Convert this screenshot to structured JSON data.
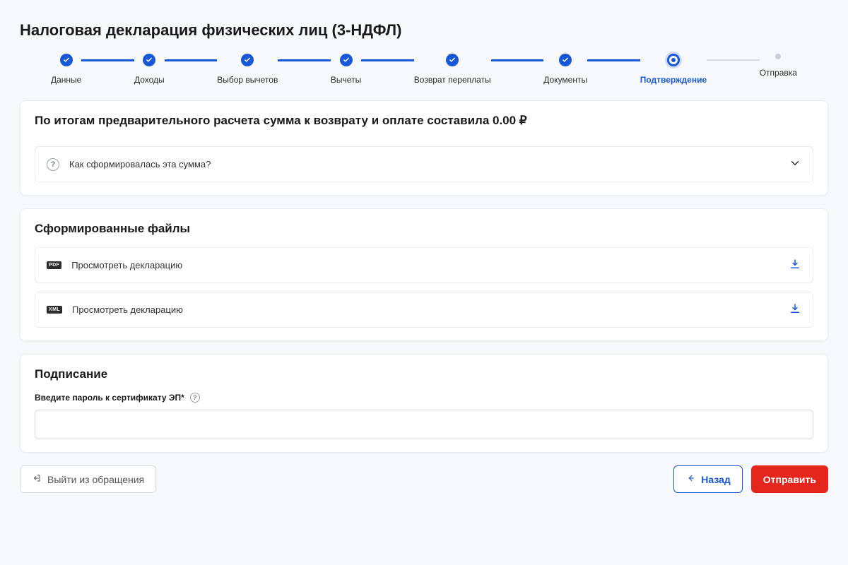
{
  "page": {
    "title": "Налоговая декларация физических лиц (3-НДФЛ)"
  },
  "stepper": {
    "steps": [
      {
        "label": "Данные"
      },
      {
        "label": "Доходы"
      },
      {
        "label": "Выбор вычетов"
      },
      {
        "label": "Вычеты"
      },
      {
        "label": "Возврат переплаты"
      },
      {
        "label": "Документы"
      },
      {
        "label": "Подтверждение"
      },
      {
        "label": "Отправка"
      }
    ]
  },
  "summary": {
    "title": "По итогам предварительного расчета сумма к возврату и оплате составила 0.00 ₽",
    "how_formed": "Как сформировалась эта сумма?"
  },
  "files": {
    "title": "Сформированные файлы",
    "items": [
      {
        "badge": "PDF",
        "label": "Просмотреть декларацию"
      },
      {
        "badge": "XML",
        "label": "Просмотреть декларацию"
      }
    ]
  },
  "sign": {
    "title": "Подписание",
    "label": "Введите пароль к сертификату ЭП*",
    "value": ""
  },
  "footer": {
    "exit": "Выйти из обращения",
    "back": "Назад",
    "submit": "Отправить"
  }
}
